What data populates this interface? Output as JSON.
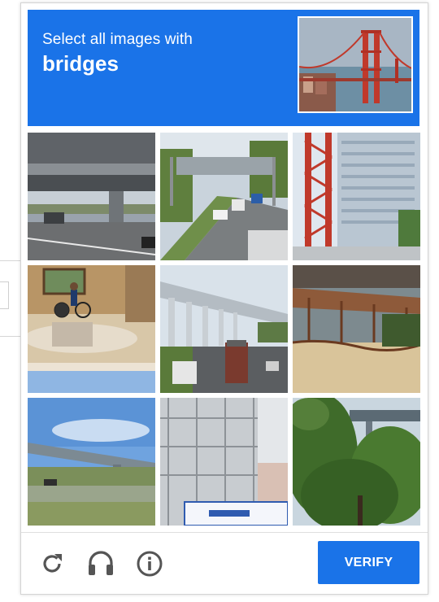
{
  "challenge": {
    "instruction_line": "Select all images with",
    "target_word": "bridges"
  },
  "tiles": [
    {
      "name": "tile-1",
      "scene": "underpass-road"
    },
    {
      "name": "tile-2",
      "scene": "highway-sign-gantry"
    },
    {
      "name": "tile-3",
      "scene": "tall-building-red-frame"
    },
    {
      "name": "tile-4",
      "scene": "plaza-with-cyclist"
    },
    {
      "name": "tile-5",
      "scene": "elevated-viaduct-highway"
    },
    {
      "name": "tile-6",
      "scene": "pergola-wall"
    },
    {
      "name": "tile-7",
      "scene": "overpass-field"
    },
    {
      "name": "tile-8",
      "scene": "scaffolding-building"
    },
    {
      "name": "tile-9",
      "scene": "trees-with-bridge"
    }
  ],
  "footer": {
    "reload_icon": "reload-icon",
    "audio_icon": "headphones-icon",
    "info_icon": "info-icon",
    "verify_label": "VERIFY"
  },
  "colors": {
    "accent": "#1a73e8",
    "icon_gray": "#555555"
  }
}
